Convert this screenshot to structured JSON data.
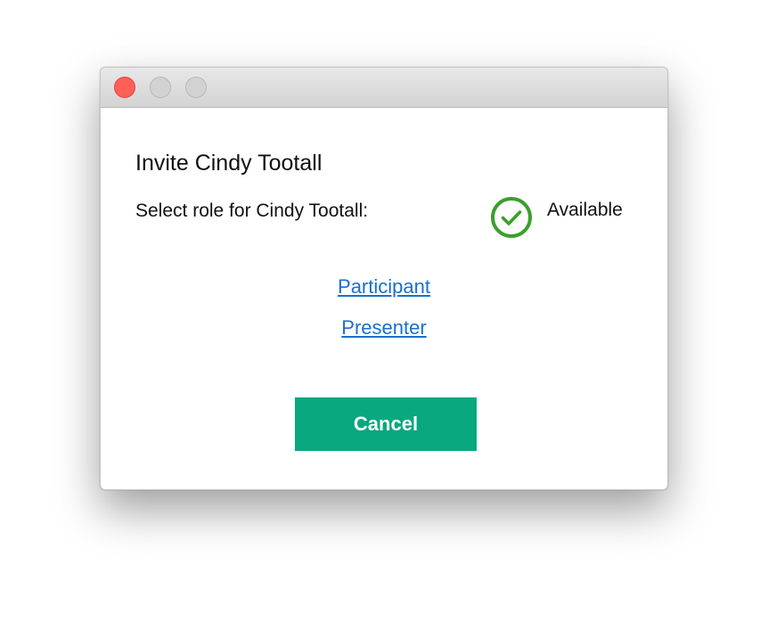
{
  "window": {
    "traffic_lights": [
      {
        "name": "close",
        "color": "#fe5f57"
      },
      {
        "name": "minimize",
        "color": "#d2d2d2"
      },
      {
        "name": "zoom",
        "color": "#d2d2d2"
      }
    ]
  },
  "dialog": {
    "title": "Invite Cindy Tootall",
    "role_prompt": "Select role for Cindy Tootall:",
    "status": {
      "icon": "check-circle-icon",
      "color": "#3aa02b",
      "label": "Available"
    },
    "roles": [
      {
        "label": "Participant"
      },
      {
        "label": "Presenter"
      }
    ],
    "cancel_label": "Cancel"
  },
  "colors": {
    "link": "#1a6fcf",
    "button": "#09a87f"
  }
}
